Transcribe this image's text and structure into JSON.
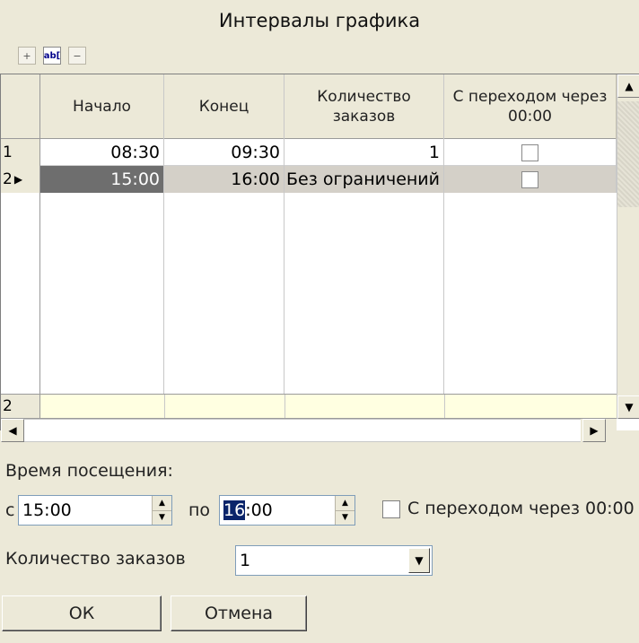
{
  "window": {
    "title": "Интервалы графика"
  },
  "toolbar": {
    "icons": [
      "add-row-icon",
      "edit-text-icon",
      "delete-row-icon"
    ],
    "edit_label": "ab["
  },
  "grid": {
    "headers": [
      "Начало",
      "Конец",
      "Количество заказов",
      "С переходом через 00:00"
    ],
    "rows": [
      {
        "num": "1",
        "start": "08:30",
        "end": "09:30",
        "count": "1",
        "cross": false
      },
      {
        "num": "2",
        "start": "15:00",
        "end": "16:00",
        "count": "Без ограничений",
        "cross": false,
        "selected": true
      }
    ],
    "footer_num": "2"
  },
  "form": {
    "visit_time_label": "Время посещения:",
    "from_label": "с",
    "from_value": "15:00",
    "to_label": "по",
    "to_value_hl": "16",
    "to_value_rest": ":00",
    "cross_label": "С переходом через 00:00",
    "orders_label": "Количество заказов",
    "orders_value": "1"
  },
  "buttons": {
    "ok": "ОК",
    "cancel": "Отмена"
  },
  "colors": {
    "bg": "#ECE9D8",
    "highlight": "#0A246A",
    "footer": "#FFFFE1"
  }
}
